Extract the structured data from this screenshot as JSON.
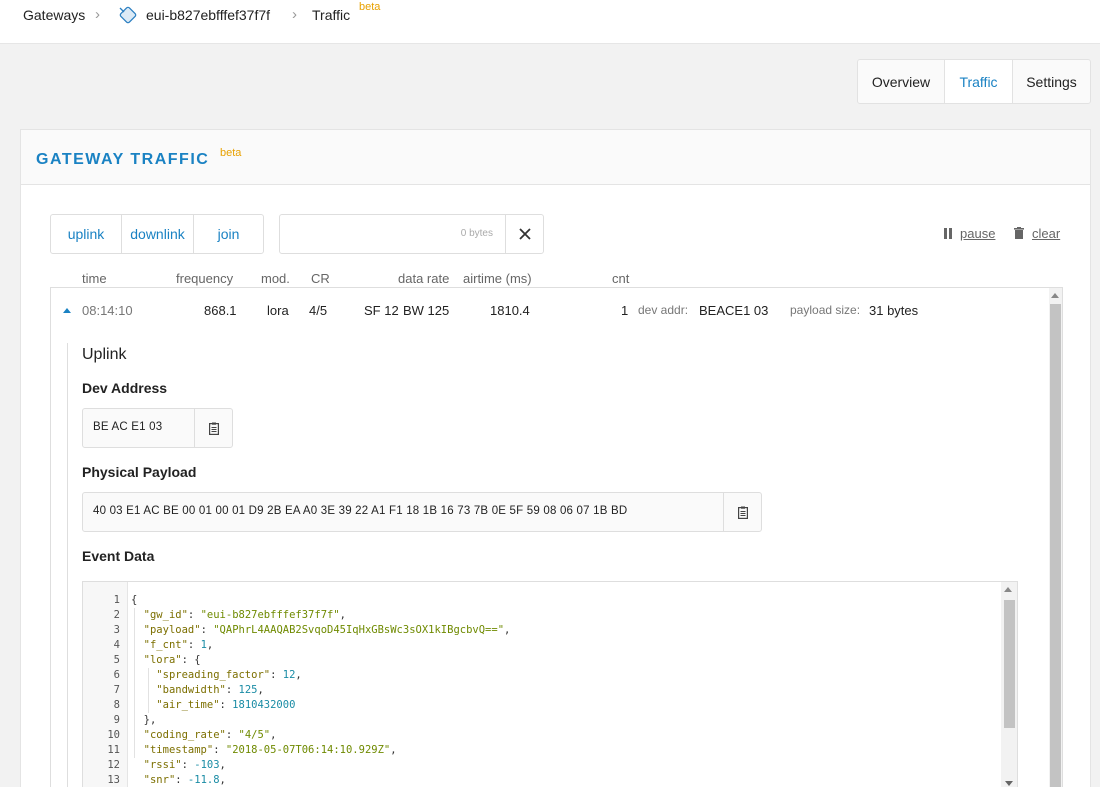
{
  "breadcrumb": {
    "gateways": "Gateways",
    "gateway_id": "eui-b827ebfffef37f7f",
    "traffic": "Traffic",
    "beta": "beta"
  },
  "tabs": [
    "Overview",
    "Traffic",
    "Settings"
  ],
  "active_tab": "Traffic",
  "panel": {
    "title": "GATEWAY TRAFFIC",
    "beta": "beta"
  },
  "filters": [
    "uplink",
    "downlink",
    "join"
  ],
  "search": {
    "bytes_label": "0 bytes"
  },
  "controls": {
    "pause": "pause",
    "clear": "clear"
  },
  "columns": {
    "time": "time",
    "frequency": "frequency",
    "mod": "mod.",
    "cr": "CR",
    "data_rate": "data rate",
    "airtime": "airtime (ms)",
    "cnt": "cnt"
  },
  "row": {
    "time": "08:14:10",
    "frequency": "868.1",
    "mod": "lora",
    "cr": "4/5",
    "sf": "SF 12",
    "bw": "BW 125",
    "airtime": "1810.4",
    "cnt": "1",
    "dev_addr_label": "dev addr:",
    "dev_addr": "BEACE1 03",
    "payload_size_label": "payload size:",
    "payload_size": "31 bytes"
  },
  "details": {
    "title": "Uplink",
    "dev_address_label": "Dev Address",
    "dev_address": "BE AC E1 03",
    "physical_payload_label": "Physical Payload",
    "physical_payload": "40 03 E1 AC BE 00 01 00 01 D9 2B EA A0 3E 39 22 A1 F1 18 1B 16 73 7B 0E 5F 59 08 06 07 1B BD",
    "event_data_label": "Event Data"
  },
  "event_data": {
    "line_numbers": [
      "1",
      "2",
      "3",
      "4",
      "5",
      "6",
      "7",
      "8",
      "9",
      "10",
      "11",
      "12",
      "13"
    ],
    "gw_id": "eui-b827ebfffef37f7f",
    "payload": "QAPhrL4AAQAB2SvqoD45IqHxGBsWc3sOX1kIBgcbvQ==",
    "f_cnt": "1",
    "spreading_factor": "12",
    "bandwidth": "125",
    "air_time": "1810432000",
    "coding_rate": "4/5",
    "timestamp": "2018-05-07T06:14:10.929Z",
    "rssi": "-103",
    "snr": "-11.8"
  },
  "colors": {
    "accent": "#1a82c3",
    "beta": "#e8a100"
  }
}
